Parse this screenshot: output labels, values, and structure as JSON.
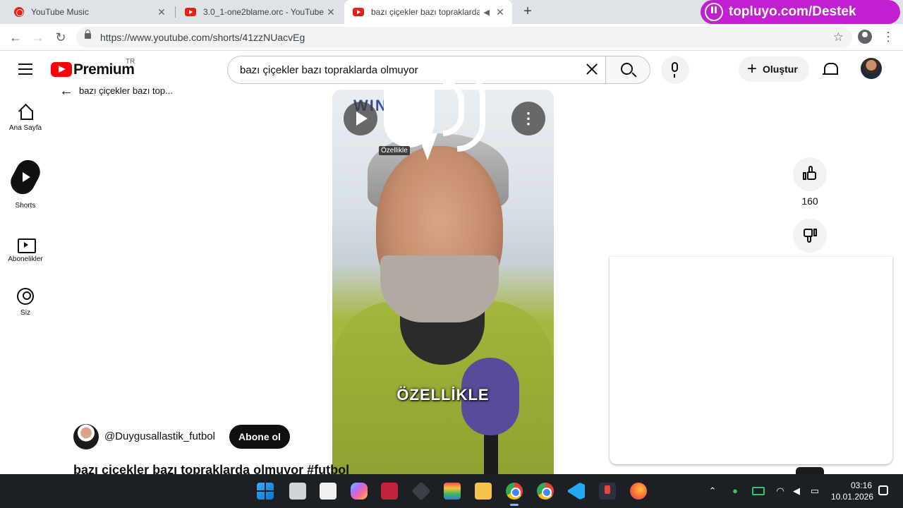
{
  "browser": {
    "tabs": [
      {
        "title": "YouTube Music",
        "active": false
      },
      {
        "title": "3.0_1-one2blame.orc - YouTube",
        "active": false
      },
      {
        "title": "bazı çiçekler bazı topraklarda olmuyor",
        "active": true,
        "audio": true
      }
    ],
    "url": "https://www.youtube.com/shorts/41zzNUacvEg",
    "overlay_brand": "topluyo.com/Destek"
  },
  "masthead": {
    "logo_text": "Premium",
    "region": "TR",
    "search_query": "bazı çiçekler bazı topraklarda olmuyor",
    "create_label": "Oluştur"
  },
  "guide": [
    {
      "label": "Ana Sayfa",
      "icon": "home-icon"
    },
    {
      "label": "Shorts",
      "icon": "shorts-icon"
    },
    {
      "label": "Abonelikler",
      "icon": "subscriptions-icon"
    },
    {
      "label": "Siz",
      "icon": "you-icon"
    }
  ],
  "short": {
    "back_title": "bazı çiçekler bazı top...",
    "caption": "ÖZELLİKLE",
    "volume_tooltip": "Özellikle",
    "channel": "@Duygusallastik_futbol",
    "subscribe_label": "Abone ol",
    "title": "bazı çiçekler bazı topraklarda olmuyor #futbol",
    "likes": "160"
  },
  "taskbar": {
    "time": "03:16",
    "date": "10.01.2026"
  },
  "colors": {
    "youtube_red": "#ff0000",
    "brand_pill": "#c21fd0",
    "taskbar": "#1c1f24"
  }
}
